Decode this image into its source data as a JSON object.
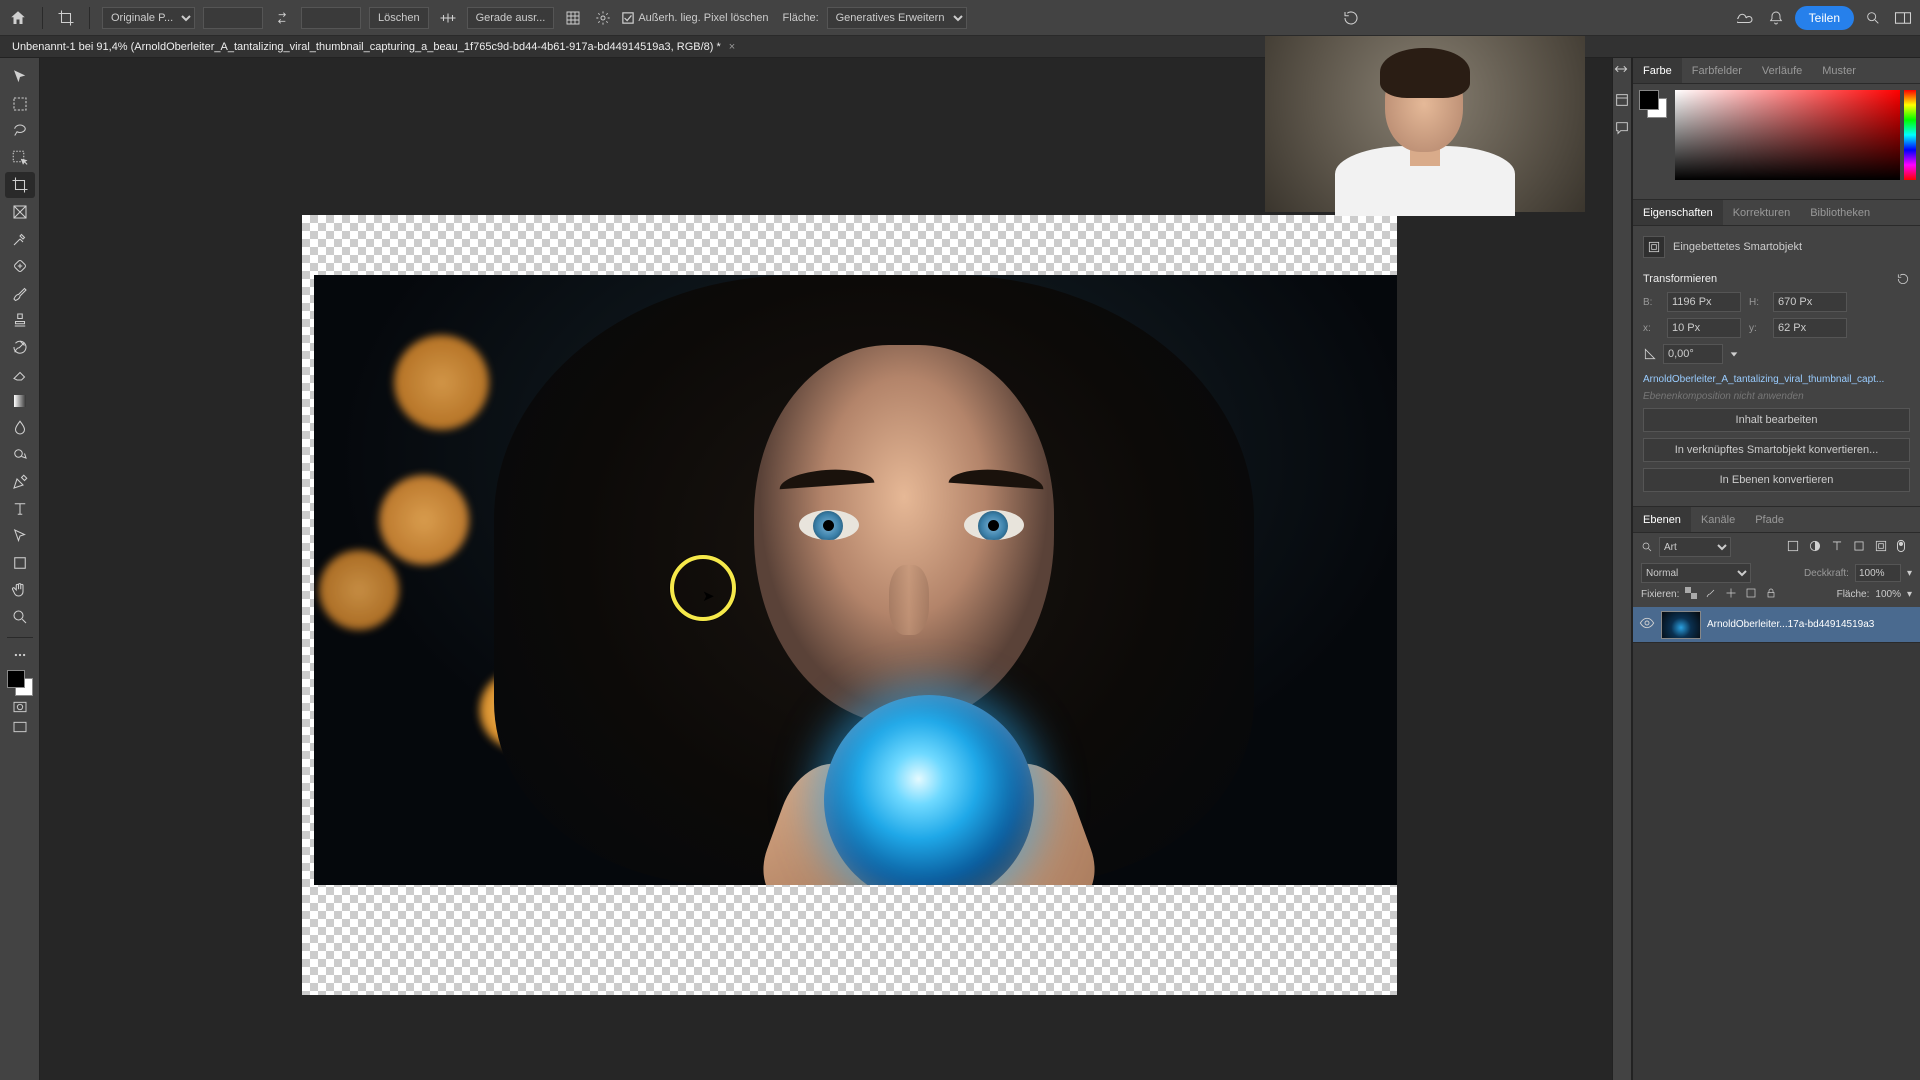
{
  "menubar": {
    "ratio": "Originale P...",
    "delete_btn": "Löschen",
    "delete_outside": "Außerh. lieg. Pixel löschen",
    "fill_label": "Fläche:",
    "fill_mode": "Generatives Erweitern",
    "share": "Teilen"
  },
  "doc": {
    "title": "Unbenannt-1 bei 91,4% (ArnoldOberleiter_A_tantalizing_viral_thumbnail_capturing_a_beau_1f765c9d-bd44-4b61-917a-bd44914519a3, RGB/8) *"
  },
  "panels": {
    "color_tabs": [
      "Farbe",
      "Farbfelder",
      "Verläufe",
      "Muster"
    ],
    "props_tabs": [
      "Eigenschaften",
      "Korrekturen",
      "Bibliotheken"
    ],
    "layers_tabs": [
      "Ebenen",
      "Kanäle",
      "Pfade"
    ]
  },
  "properties": {
    "smartobject_label": "Eingebettetes Smartobjekt",
    "transform_label": "Transformieren",
    "w_label": "B:",
    "h_label": "H:",
    "x_label": "x:",
    "y_label": "y:",
    "w": "1196 Px",
    "h": "670 Px",
    "x": "10 Px",
    "y": "62 Px",
    "angle": "0,00°",
    "linked_name": "ArnoldOberleiter_A_tantalizing_viral_thumbnail_capt...",
    "layercomp_disabled": "Ebenenkomposition nicht anwenden",
    "btn_edit": "Inhalt bearbeiten",
    "btn_convert_linked": "In verknüpftes Smartobjekt konvertieren...",
    "btn_convert_layers": "In Ebenen konvertieren"
  },
  "layers": {
    "search_kind": "Art",
    "blend_mode": "Normal",
    "opacity_label": "Deckkraft:",
    "opacity": "100%",
    "fill_label": "Fläche:",
    "fill": "100%",
    "lock_label": "Fixieren:",
    "layer_name": "ArnoldOberleiter...17a-bd44914519a3"
  }
}
